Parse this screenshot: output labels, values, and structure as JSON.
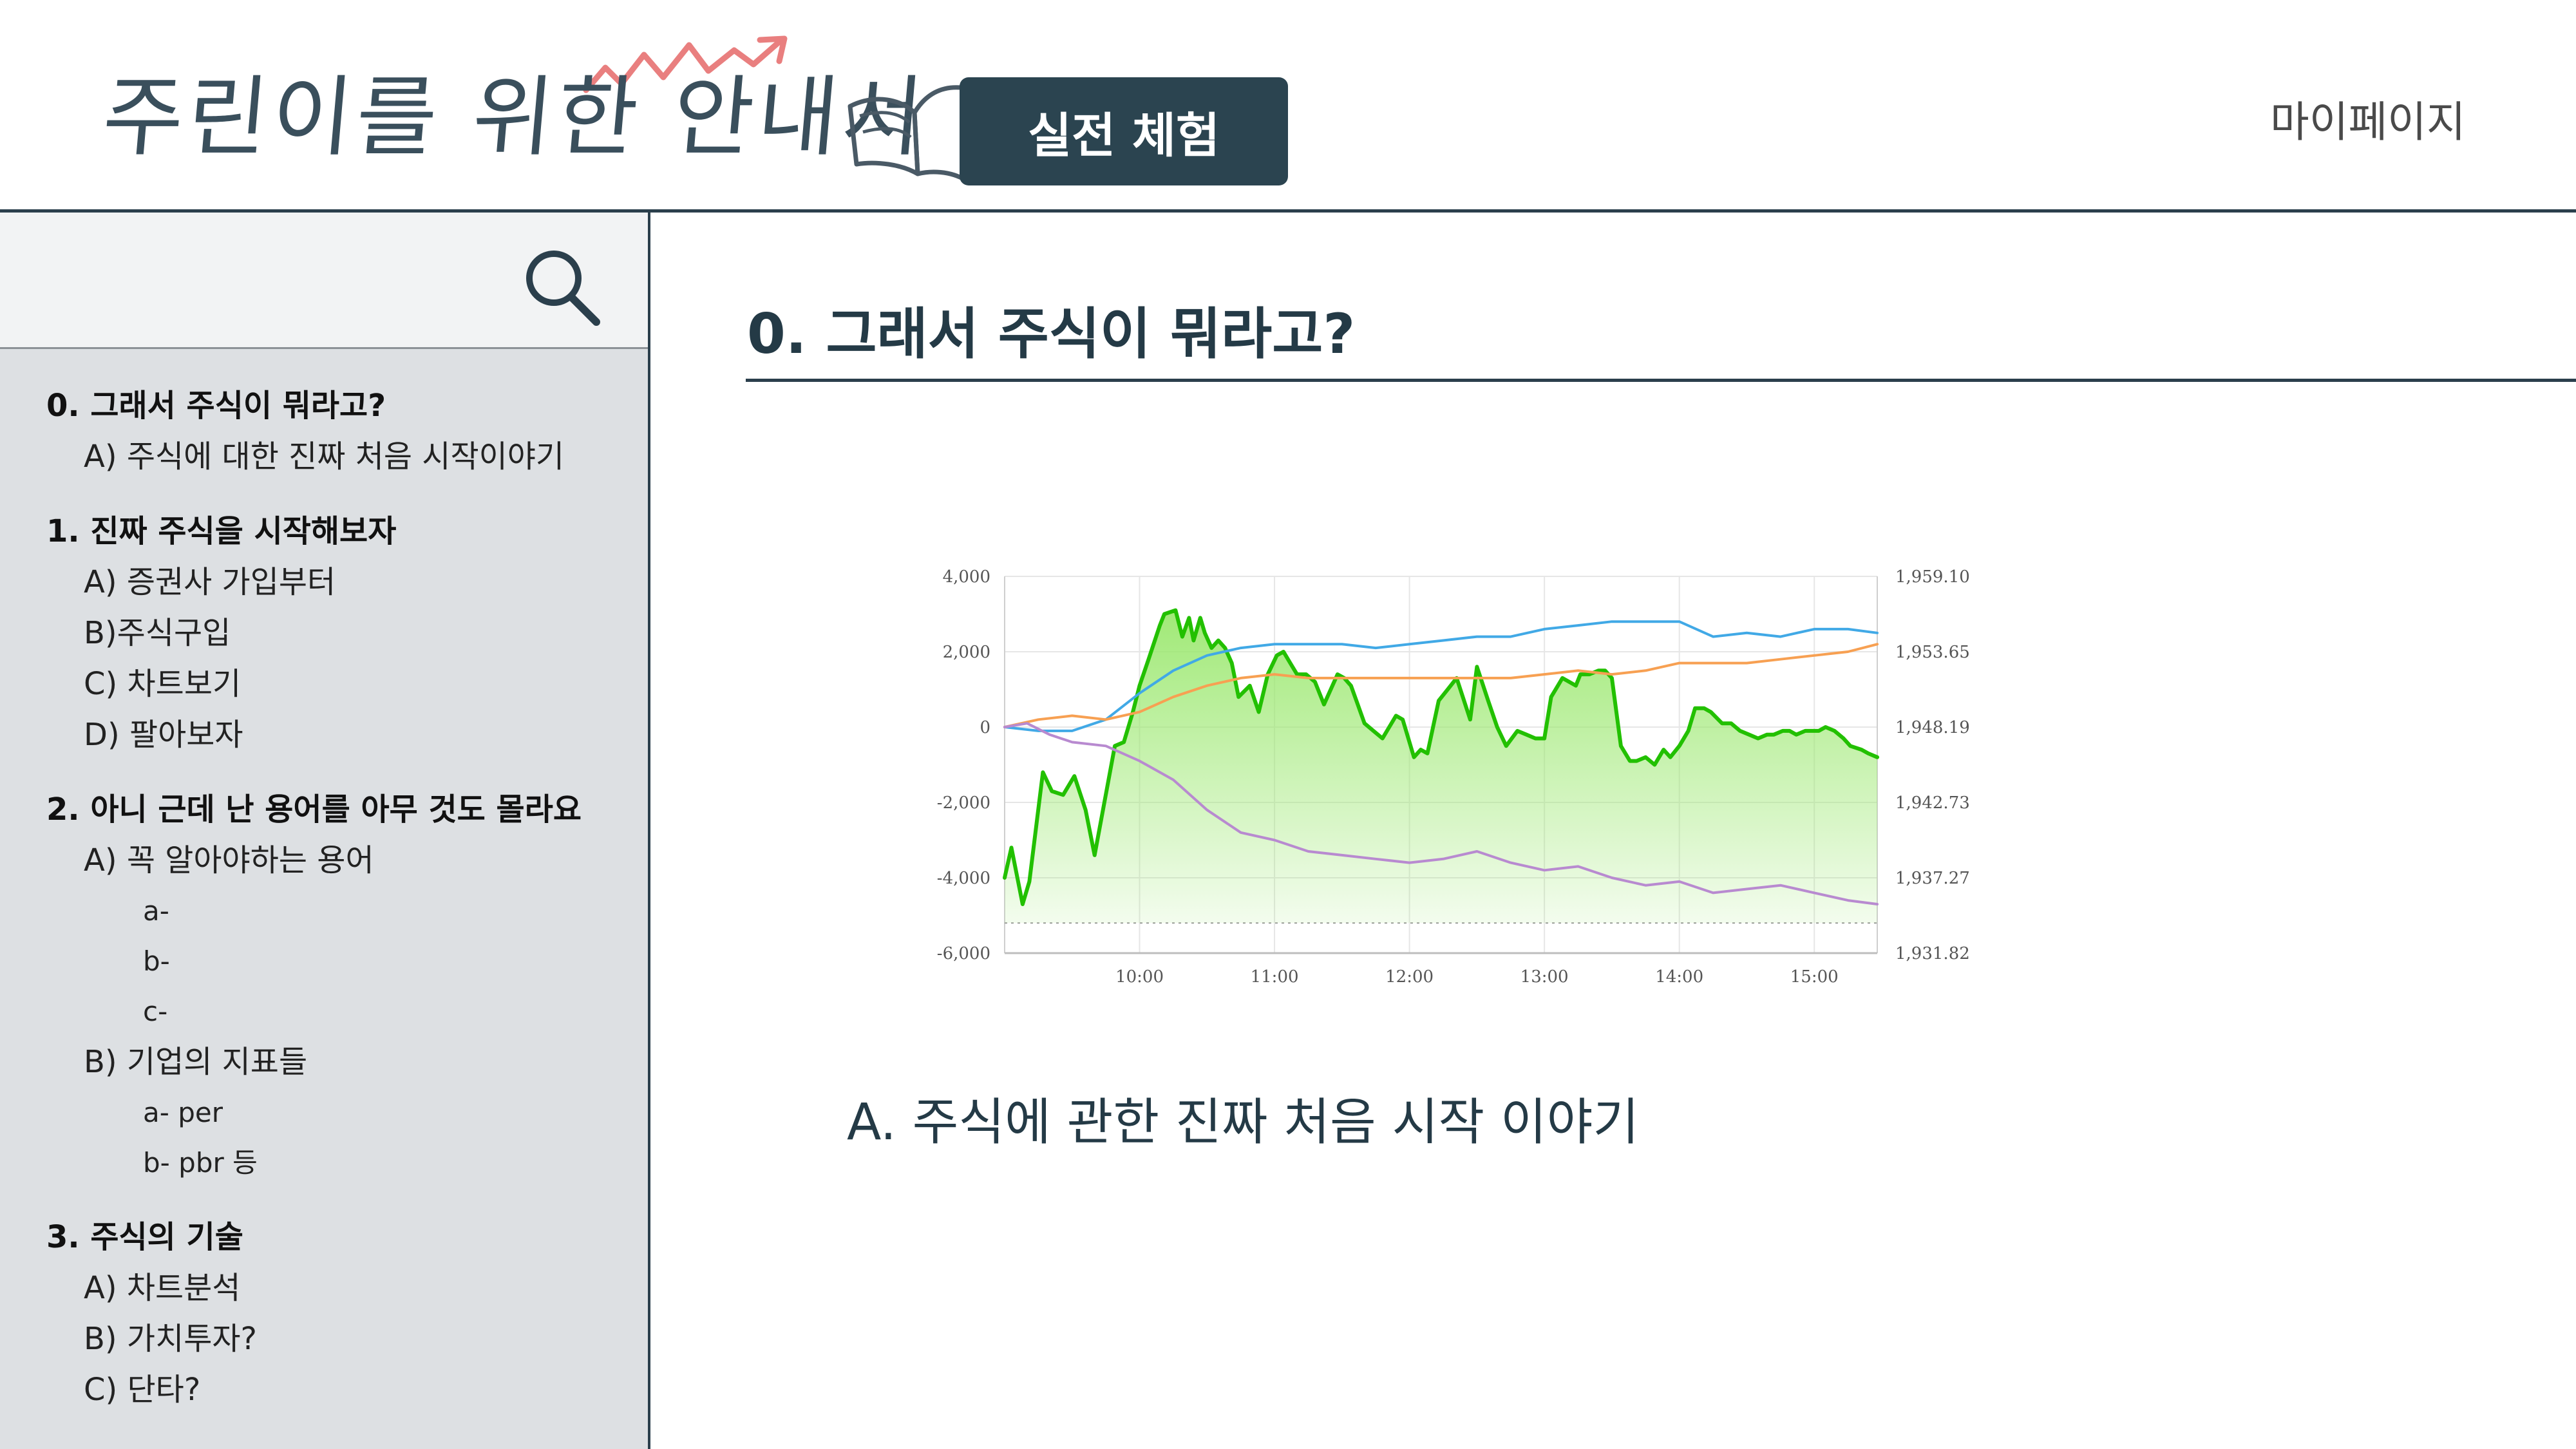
{
  "header": {
    "logo_text": "주린이를 위한 안내서",
    "cta_label": "실전 체험",
    "mypage_label": "마이페이지"
  },
  "sidebar": {
    "search_placeholder": "",
    "sections": [
      {
        "title": "0. 그래서 주식이 뭐라고?",
        "items": [
          {
            "label": "A) 주식에 대한 진짜 처음 시작이야기"
          }
        ]
      },
      {
        "title": "1. 진짜 주식을 시작해보자",
        "items": [
          {
            "label": "A) 증권사 가입부터"
          },
          {
            "label": "B)주식구입"
          },
          {
            "label": "C) 차트보기"
          },
          {
            "label": "D) 팔아보자"
          }
        ]
      },
      {
        "title": "2. 아니 근데 난 용어를 아무 것도 몰라요",
        "items": [
          {
            "label": "A) 꼭 알아야하는 용어",
            "subitems": [
              "a-",
              "b-",
              "c-"
            ]
          },
          {
            "label": "B) 기업의 지표들",
            "subitems": [
              "a- per",
              "b- pbr 등"
            ]
          }
        ]
      },
      {
        "title": "3. 주식의 기술",
        "items": [
          {
            "label": "A) 차트분석"
          },
          {
            "label": "B) 가치투자?"
          },
          {
            "label": "C) 단타?"
          }
        ]
      }
    ]
  },
  "main": {
    "title": "0. 그래서 주식이 뭐라고?",
    "subtitle": "A. 주식에 관한 진짜 처음 시작 이야기"
  },
  "chart_data": {
    "type": "line",
    "title": "",
    "xlabel": "",
    "ylabel": "",
    "x_ticks": [
      "10:00",
      "11:00",
      "12:00",
      "13:00",
      "14:00",
      "15:00"
    ],
    "x_range": [
      "09:00",
      "15:30"
    ],
    "y_left_ticks": [
      "4,000",
      "2,000",
      "0",
      "-2,000",
      "-4,000",
      "-6,000"
    ],
    "y_left_range": [
      -6000,
      4000
    ],
    "y_right_ticks": [
      "1,959.10",
      "1,953.65",
      "1,948.19",
      "1,942.73",
      "1,937.27",
      "1,931.82"
    ],
    "y_right_range": [
      1931.82,
      1959.1
    ],
    "grid": true,
    "colors": {
      "green": "#22c000",
      "green_fill": "#9be86f",
      "blue": "#41a9e6",
      "orange": "#f7a052",
      "purple": "#b88ad0",
      "grid": "#e6e6e6"
    },
    "series": [
      {
        "axis": "left",
        "color": "green",
        "fill": true,
        "x": [
          0,
          3,
          8,
          11,
          17,
          21,
          26,
          31,
          36,
          40,
          49,
          53,
          57,
          60,
          64,
          69,
          71,
          76,
          79,
          82,
          84,
          87,
          89,
          92,
          95,
          98,
          101,
          104,
          109,
          113,
          117,
          121,
          124,
          127,
          130,
          134,
          138,
          142,
          145,
          148,
          151,
          154,
          157,
          160,
          164,
          168,
          171,
          174,
          177,
          182,
          185,
          188,
          193,
          197,
          201,
          207,
          210,
          215,
          219,
          223,
          228,
          232,
          236,
          240,
          243,
          246,
          248,
          251,
          254,
          256,
          260,
          264,
          267,
          270,
          274,
          278,
          281,
          285,
          289,
          293,
          296,
          300,
          304,
          307,
          311,
          314,
          319,
          323,
          327,
          331,
          335,
          339,
          342,
          346,
          349,
          352,
          356,
          359,
          362,
          365,
          369,
          373,
          376,
          381,
          384,
          388
        ],
        "y": [
          -4000,
          -3200,
          -4700,
          -4100,
          -1200,
          -1700,
          -1800,
          -1300,
          -2200,
          -3400,
          -500,
          -400,
          400,
          1100,
          1800,
          2700,
          3000,
          3100,
          2400,
          2900,
          2300,
          2900,
          2500,
          2100,
          2300,
          2100,
          1700,
          800,
          1100,
          400,
          1400,
          1900,
          2000,
          1700,
          1400,
          1400,
          1200,
          600,
          1000,
          1400,
          1300,
          1100,
          600,
          100,
          -100,
          -300,
          0,
          300,
          200,
          -800,
          -600,
          -700,
          700,
          1000,
          1300,
          200,
          1600,
          700,
          0,
          -500,
          -100,
          -200,
          -300,
          -300,
          800,
          1100,
          1300,
          1200,
          1100,
          1400,
          1400,
          1500,
          1500,
          1300,
          -500,
          -900,
          -900,
          -800,
          -1000,
          -600,
          -800,
          -500,
          -100,
          500,
          500,
          400,
          100,
          100,
          -100,
          -200,
          -300,
          -200,
          -200,
          -100,
          -100,
          -200,
          -100,
          -100,
          -100,
          0,
          -100,
          -300,
          -500,
          -600,
          -700,
          -800
        ]
      },
      {
        "axis": "left",
        "color": "blue",
        "x": [
          0,
          15,
          30,
          45,
          60,
          75,
          90,
          105,
          120,
          135,
          150,
          165,
          180,
          195,
          210,
          225,
          240,
          255,
          270,
          285,
          300,
          315,
          330,
          345,
          360,
          375,
          388
        ],
        "y": [
          0,
          -100,
          -100,
          200,
          900,
          1500,
          1900,
          2100,
          2200,
          2200,
          2200,
          2100,
          2200,
          2300,
          2400,
          2400,
          2600,
          2700,
          2800,
          2800,
          2800,
          2400,
          2500,
          2400,
          2600,
          2600,
          2500
        ]
      },
      {
        "axis": "left",
        "color": "orange",
        "x": [
          0,
          15,
          30,
          45,
          60,
          75,
          90,
          105,
          120,
          135,
          150,
          165,
          180,
          195,
          210,
          225,
          240,
          255,
          270,
          285,
          300,
          315,
          330,
          345,
          360,
          375,
          388
        ],
        "y": [
          0,
          200,
          300,
          200,
          400,
          800,
          1100,
          1300,
          1400,
          1300,
          1300,
          1300,
          1300,
          1300,
          1300,
          1300,
          1400,
          1500,
          1400,
          1500,
          1700,
          1700,
          1700,
          1800,
          1900,
          2000,
          2200
        ]
      },
      {
        "axis": "left",
        "color": "purple",
        "x": [
          0,
          10,
          20,
          30,
          45,
          60,
          75,
          90,
          105,
          120,
          135,
          150,
          165,
          180,
          195,
          210,
          225,
          240,
          255,
          270,
          285,
          300,
          315,
          330,
          345,
          360,
          375,
          388
        ],
        "y": [
          0,
          100,
          -200,
          -400,
          -500,
          -900,
          -1400,
          -2200,
          -2800,
          -3000,
          -3300,
          -3400,
          -3500,
          -3600,
          -3500,
          -3300,
          -3600,
          -3800,
          -3700,
          -4000,
          -4200,
          -4100,
          -4400,
          -4300,
          -4200,
          -4400,
          -4600,
          -4700
        ]
      }
    ]
  }
}
